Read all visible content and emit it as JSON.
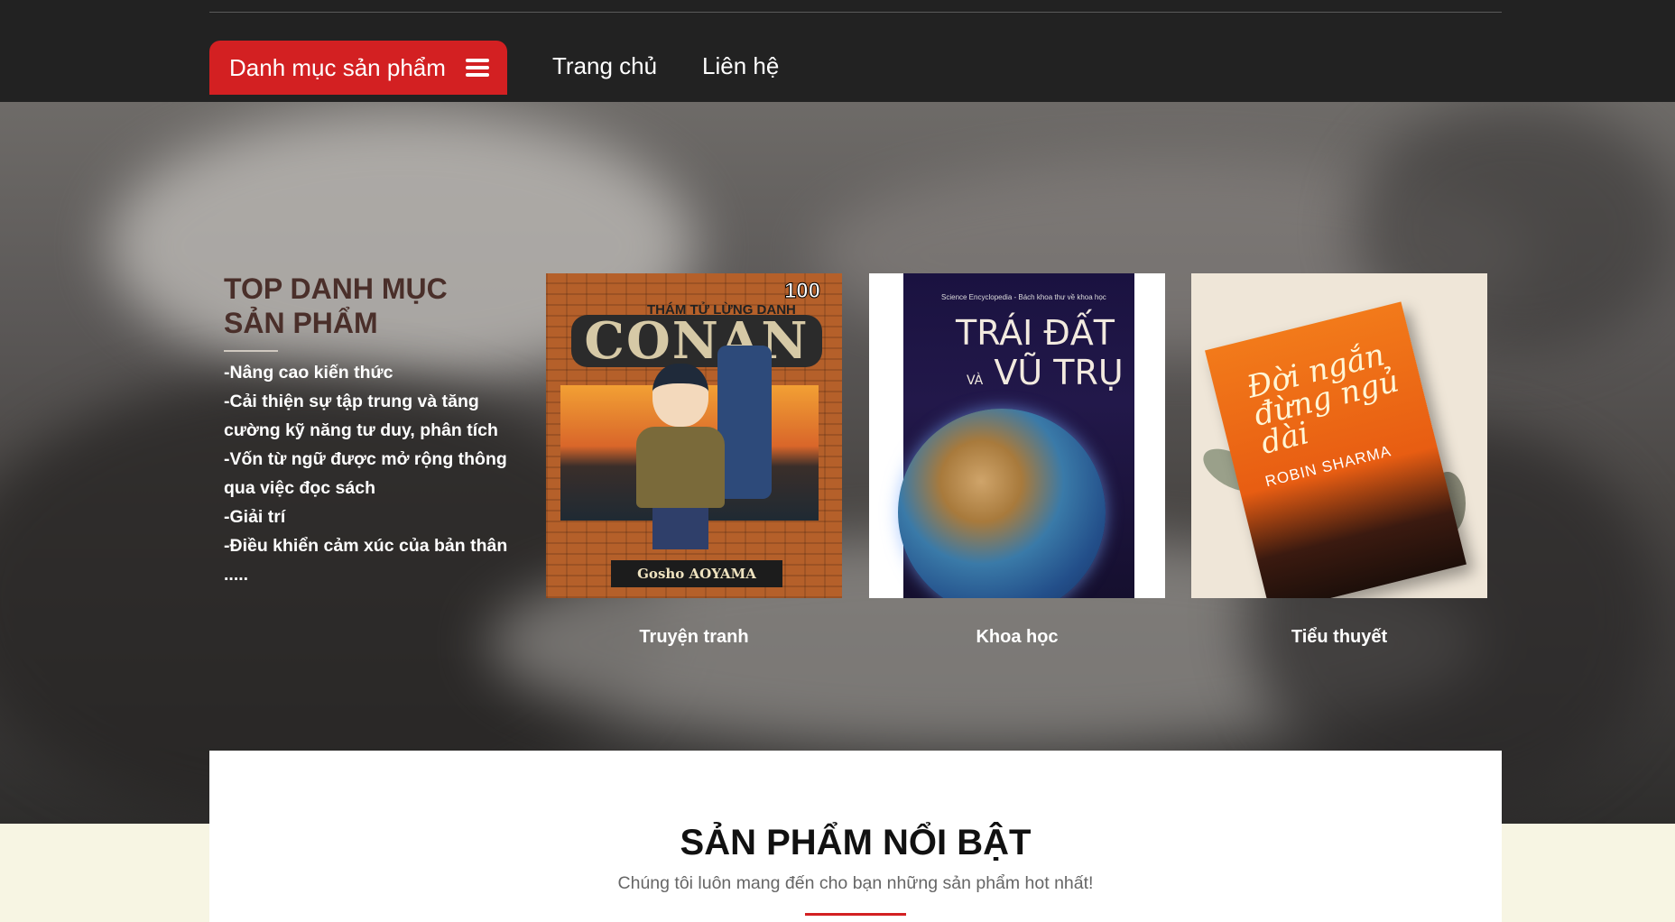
{
  "nav": {
    "category_button": "Danh mục sản phẩm",
    "home": "Trang chủ",
    "contact": "Liên hệ"
  },
  "hero": {
    "title": "TOP DANH MỤC SẢN PHẨM",
    "benefits": [
      "-Nâng cao kiến thức",
      "-Cải thiện sự tập trung và tăng cường kỹ năng tư duy, phân tích",
      "-Vốn từ ngữ được mở rộng thông qua việc đọc sách",
      "-Giải trí",
      "-Điều khiển cảm xúc của bản thân",
      "....."
    ],
    "categories": [
      {
        "label": "Truyện tranh",
        "cover": {
          "number": "100",
          "subtitle": "THÁM TỬ LỪNG DANH",
          "logo": "CONAN",
          "author": "Gosho AOYAMA"
        }
      },
      {
        "label": "Khoa học",
        "cover": {
          "small": "Science Encyclopedia - Bách khoa thư về khoa học",
          "line1": "TRÁI ĐẤT",
          "joiner": "VÀ",
          "line2": "VŨ TRỤ"
        }
      },
      {
        "label": "Tiểu thuyết",
        "cover": {
          "title": "Đời ngắn đừng ngủ dài",
          "author": "ROBIN SHARMA"
        }
      }
    ]
  },
  "featured": {
    "title": "SẢN PHẨM NỔI BẬT",
    "subtitle": "Chúng tôi luôn mang đến cho bạn những sản phẩm hot nhất!"
  },
  "colors": {
    "accent": "#d32022",
    "nav_bg": "#222222",
    "title": "#4a2f2a",
    "page_bg": "#f7f5e3"
  },
  "icons": {
    "menu": "hamburger-icon"
  }
}
